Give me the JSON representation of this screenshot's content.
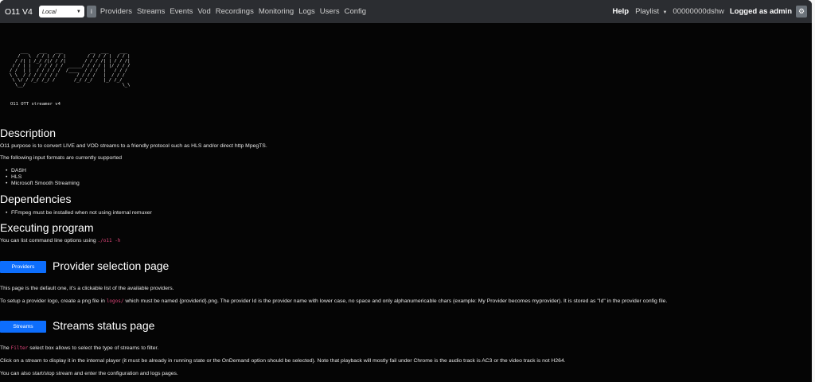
{
  "navbar": {
    "brand": "O11 V4",
    "mode_select": "Local",
    "info_label": "i",
    "links": [
      "Providers",
      "Streams",
      "Events",
      "Vod",
      "Recordings",
      "Monitoring",
      "Logs",
      "Users",
      "Config"
    ],
    "help": "Help",
    "playlist": "Playlist",
    "id": "00000000dshw",
    "logged": "Logged as admin"
  },
  "readme": {
    "ascii_art": "    ___    ___   ___          __  ___    ___\n   /   \\  / / | / / |        / / / / |  / / |\n  / /| | /_/ /|/ / /|       / / / /| | / / /|\n / / | |   / / / / /  _____/ / / / | |/ / / /\n/ /  | |  / / / / /  /____  / / /  |   / / /\n\\ \\  / / / / / / /       / / / /   |  / / /\n \\ \\/ / /_/ /_/ /       /_/ /_/    |_/ /_/\n  \\__/                                    \\_\\",
    "subtitle": "O11 OTT streamer v4",
    "description_title": "Description",
    "description_text": "O11 purpose is to convert LIVE and VOD streams to a friendly protocol such as HLS and/or direct http MpegTS.",
    "formats_intro": "The following input formats are currently supported",
    "formats": [
      "DASH",
      "HLS",
      "Microsoft Smooth Streaming"
    ],
    "dependencies_title": "Dependencies",
    "dependencies": [
      "FFmpeg must be installed when not using internal remuxer"
    ],
    "executing_title": "Executing program",
    "executing_text": "You can list command line options using",
    "executing_code": "./o11 -h",
    "providers_button": "Providers",
    "providers_title": "Provider selection page",
    "providers_p1": "This page is the default one, it's a clickable list of the available providers.",
    "providers_p2_pre": "To setup a provider logo, create a png file in",
    "providers_p2_code": "logos/",
    "providers_p2_post": "which must be named {providerid}.png. The provider Id is the provider name with lower case, no space and only alphanumericable chars (example: My Provider becomes myprovider). It is stored as \"Id\" in the provider config file.",
    "streams_button": "Streams",
    "streams_title": "Streams status page",
    "streams_p1_pre": "The",
    "streams_p1_code": "Filter",
    "streams_p1_post": "select box allows to select the type of streams to filter.",
    "streams_p2": "Click on a stream to display it in the internal player (it must be already in running state or the OnDemand option should be selected). Note that playback will mostly fail under Chrome is the audio track is AC3 or the video track is not H264.",
    "streams_p3": "You can also start/stop stream and enter the configuration and logs pages."
  },
  "colors": {
    "accent": "#0d6efd",
    "navbar": "#2b2d31",
    "background": "#050505",
    "code": "#e0467a"
  }
}
